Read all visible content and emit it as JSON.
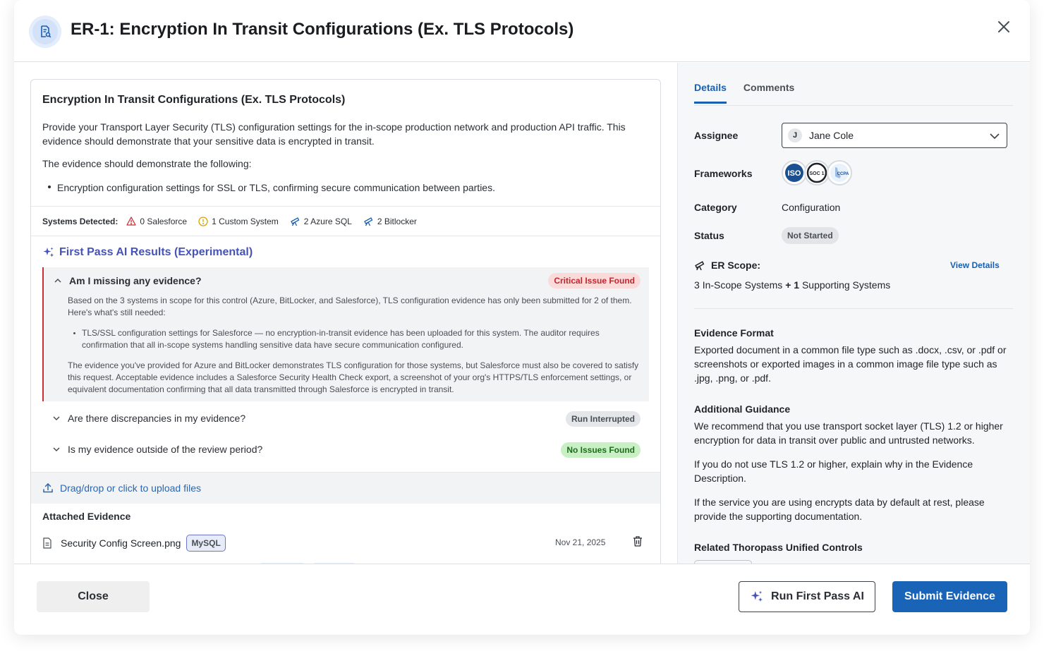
{
  "header": {
    "title": "ER-1: Encryption In Transit Configurations (Ex. TLS Protocols)"
  },
  "request": {
    "title": "Encryption In Transit Configurations (Ex. TLS Protocols)",
    "description": "Provide your Transport Layer Security (TLS) configuration settings for the in-scope production network and production API traffic. This evidence should demonstrate that your sensitive data is encrypted in transit.",
    "demonstrate_intro": "The evidence should demonstrate the following:",
    "bullets": [
      "Encryption configuration settings for SSL or TLS, confirming secure communication between parties."
    ]
  },
  "systems": {
    "label": "Systems Detected:",
    "items": [
      {
        "text": "0 Salesforce",
        "icon": "warning-triangle-icon"
      },
      {
        "text": "1 Custom System",
        "icon": "alert-circle-icon"
      },
      {
        "text": "2 Azure SQL",
        "icon": "telescope-icon"
      },
      {
        "text": "2 Bitlocker",
        "icon": "telescope-icon"
      }
    ]
  },
  "ai": {
    "title": "First Pass AI Results (Experimental)",
    "questions": [
      {
        "question": "Am I missing any evidence?",
        "badge": "Critical Issue Found",
        "expanded": true,
        "para1": "Based on the 3 systems in scope for this control (Azure, BitLocker, and Salesforce), TLS configuration evidence has only been submitted for 2 of them. Here's what's still needed:",
        "bullet": "TLS/SSL configuration settings for Salesforce — no encryption-in-transit evidence has been uploaded for this system. The auditor requires confirmation that all in-scope systems handling sensitive data have secure communication configured.",
        "para2": "The evidence you've provided for Azure and BitLocker demonstrates TLS configuration for those systems, but Salesforce must also be covered to satisfy this request. Acceptable evidence includes a Salesforce Security Health Check export, a screenshot of your org's HTTPS/TLS enforcement settings, or equivalent documentation confirming that all data transmitted through Salesforce is encrypted in transit."
      },
      {
        "question": "Are there discrepancies in my evidence?",
        "badge": "Run Interrupted",
        "expanded": false
      },
      {
        "question": "Is my evidence outside of the review period?",
        "badge": "No Issues Found",
        "expanded": false
      }
    ]
  },
  "upload": {
    "label": "Drag/drop or click to upload files"
  },
  "attached": {
    "title": "Attached Evidence",
    "files": [
      {
        "name": "Security Config Screen.png",
        "tag": "MySQL",
        "date": "Nov 21, 2025"
      }
    ]
  },
  "details": {
    "tabs": [
      "Details",
      "Comments"
    ],
    "active_tab": "Details",
    "assignee_label": "Assignee",
    "assignee_initial": "J",
    "assignee_name": "Jane Cole",
    "frameworks_label": "Frameworks",
    "frameworks": [
      {
        "name": "iso-logo",
        "text": "ISO"
      },
      {
        "name": "soc1-logo",
        "text": "SOC 1"
      },
      {
        "name": "ccpa-logo",
        "text": "CCPA"
      }
    ],
    "category_label": "Category",
    "category_value": "Configuration",
    "status_label": "Status",
    "status_value": "Not Started",
    "scope_label": "ER Scope:",
    "view_details": "View Details",
    "scope_in_count": "3",
    "scope_in_text": "In-Scope Systems",
    "scope_plus": "+",
    "scope_sup_count": "1",
    "scope_sup_text": "Supporting Systems",
    "evidence_format_title": "Evidence Format",
    "evidence_format_text": "Exported document in a common file type such as .docx, .csv, or .pdf or screenshots or exported images in a common image file type such as .jpg, .png, or .pdf.",
    "guidance_title": "Additional Guidance",
    "guidance_p1": "We recommend that you use transport socket layer (TLS) 1.2 or higher encryption for data in transit over public and untrusted networks.",
    "guidance_p2": "If you do not use TLS 1.2 or higher, explain why in the Evidence Description.",
    "guidance_p3": "If the service you are using encrypts data by default at rest, please provide the supporting documentation.",
    "related_title": "Related Thoropass Unified Controls"
  },
  "footer": {
    "close": "Close",
    "run_ai": "Run First Pass AI",
    "submit": "Submit Evidence"
  },
  "colors": {
    "accent": "#1a64b8",
    "ai_purple": "#4553b8",
    "critical": "#c0262d",
    "success_bg": "#c9efc4"
  }
}
